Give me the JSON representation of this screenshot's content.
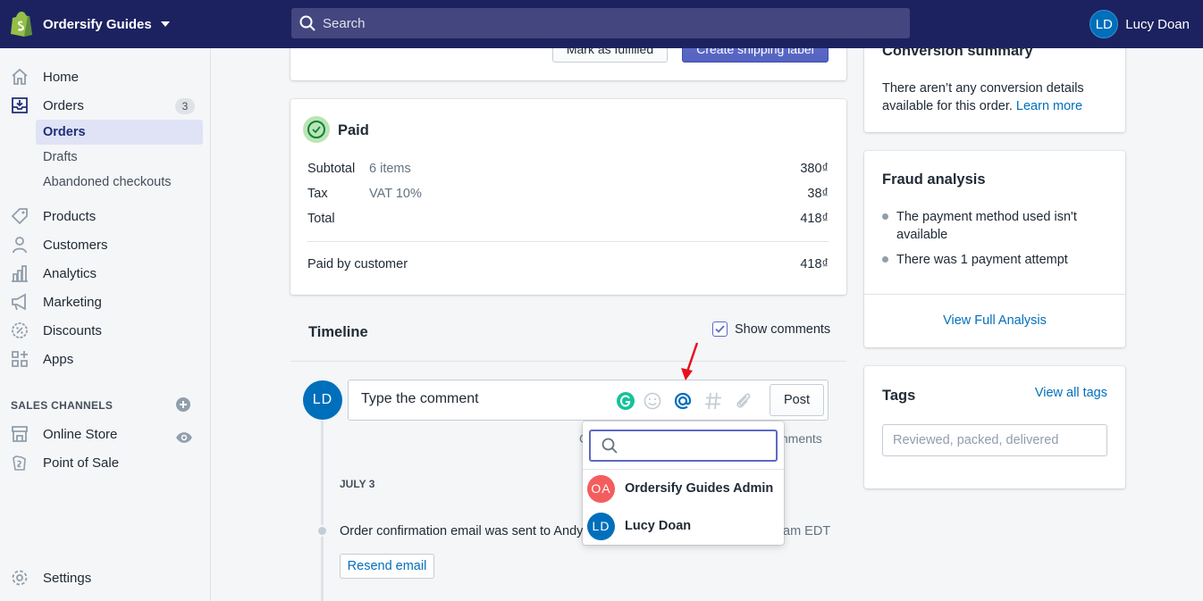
{
  "topbar": {
    "store_name": "Ordersify Guides",
    "search_placeholder": "Search",
    "user_initials": "LD",
    "user_name": "Lucy Doan"
  },
  "sidebar": {
    "items": [
      {
        "label": "Home",
        "icon": "home-icon"
      },
      {
        "label": "Orders",
        "icon": "orders-icon",
        "badge": "3"
      },
      {
        "label": "Products",
        "icon": "tag-icon"
      },
      {
        "label": "Customers",
        "icon": "person-icon"
      },
      {
        "label": "Analytics",
        "icon": "bar-chart-icon"
      },
      {
        "label": "Marketing",
        "icon": "megaphone-icon"
      },
      {
        "label": "Discounts",
        "icon": "discount-icon"
      },
      {
        "label": "Apps",
        "icon": "apps-icon"
      }
    ],
    "orders_sub": [
      "Orders",
      "Drafts",
      "Abandoned checkouts"
    ],
    "sales_channels_title": "SALES CHANNELS",
    "channels": [
      {
        "label": "Online Store",
        "icon": "store-icon"
      },
      {
        "label": "Point of Sale",
        "icon": "pos-icon"
      }
    ],
    "settings": "Settings"
  },
  "fulfill_card": {
    "mark_fulfilled": "Mark as fulfilled",
    "create_label": "Create shipping label"
  },
  "paid_card": {
    "title": "Paid",
    "rows": [
      {
        "label": "Subtotal",
        "sub": "6 items",
        "value": "380₫"
      },
      {
        "label": "Tax",
        "sub": "VAT 10%",
        "value": "38₫"
      },
      {
        "label": "Total",
        "sub": "",
        "value": "418₫"
      }
    ],
    "paid_by_label": "Paid by customer",
    "paid_by_value": "418₫"
  },
  "timeline": {
    "title": "Timeline",
    "show_comments": "Show comments",
    "comment_initials": "LD",
    "comment_placeholder": "Type the comment",
    "post": "Post",
    "hint_left": "C",
    "hint_right": "mments",
    "date": "JULY 3",
    "event": "Order confirmation email was sent to Andy I",
    "event_time": "am EDT",
    "resend": "Resend email"
  },
  "mention_popup": {
    "search_value": "",
    "users": [
      {
        "initials": "OA",
        "name": "Ordersify Guides Admin",
        "color": "#f45d5d"
      },
      {
        "initials": "LD",
        "name": "Lucy Doan",
        "color": "#006fbb"
      }
    ]
  },
  "conversion": {
    "title": "Conversion summary",
    "text": "There aren’t any conversion details available for this order.",
    "link": "Learn more"
  },
  "fraud": {
    "title": "Fraud analysis",
    "bullets": [
      "The payment method used isn't available",
      "There was 1 payment attempt"
    ],
    "view_full": "View Full Analysis"
  },
  "tags": {
    "title": "Tags",
    "view_all": "View all tags",
    "placeholder": "Reviewed, packed, delivered"
  },
  "colors": {
    "topbar": "#1c2260",
    "primary": "#5c6ac4",
    "link": "#006fbb",
    "arrow": "#e8101c"
  }
}
